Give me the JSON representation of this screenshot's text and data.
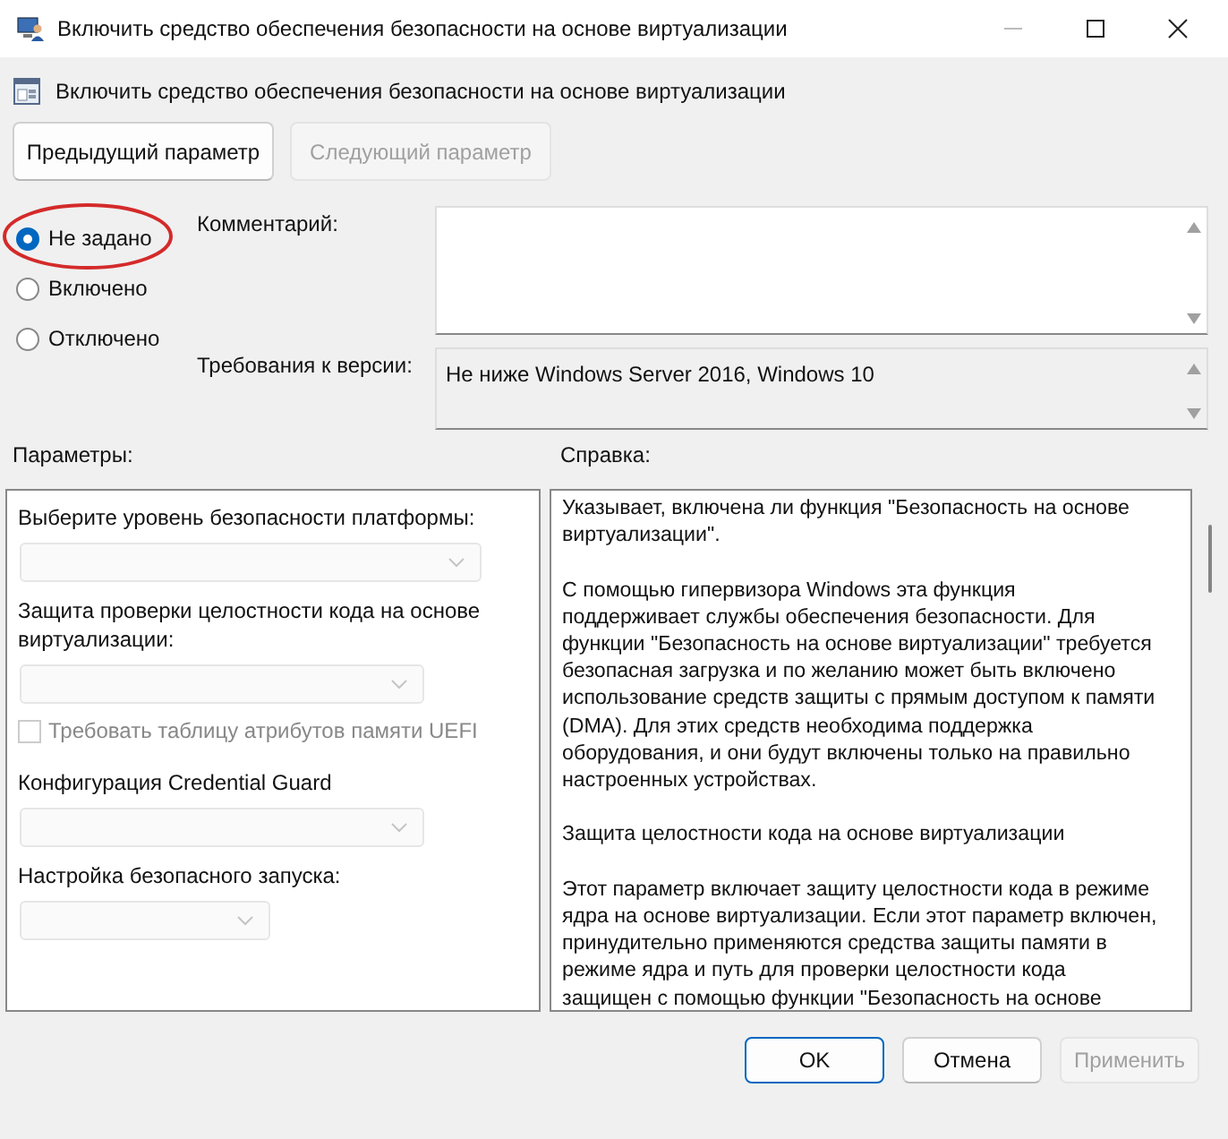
{
  "window": {
    "title": "Включить средство обеспечения безопасности на основе виртуализации"
  },
  "header": {
    "title": "Включить средство обеспечения безопасности на основе виртуализации"
  },
  "nav_buttons": [
    {
      "label": "Предыдущий параметр",
      "disabled": false
    },
    {
      "label": "Следующий параметр",
      "disabled": true
    }
  ],
  "state_options": [
    {
      "label": "Не задано",
      "selected": true
    },
    {
      "label": "Включено",
      "selected": false
    },
    {
      "label": "Отключено",
      "selected": false
    }
  ],
  "comment": {
    "label": "Комментарий:"
  },
  "requirements": {
    "label": "Требования к версии:",
    "value": "Не ниже Windows Server 2016, Windows 10"
  },
  "options_panel": {
    "title": "Параметры:",
    "items": [
      {
        "kind": "dropdown",
        "label": "Выберите уровень безопасности платформы:",
        "disabled": true
      },
      {
        "kind": "dropdown",
        "label": "Защита проверки целостности кода на основе виртуализации:",
        "disabled": true
      },
      {
        "kind": "checkbox",
        "label": "Требовать таблицу атрибутов памяти UEFI",
        "checked": false,
        "disabled": true
      },
      {
        "kind": "dropdown",
        "label": "Конфигурация Credential Guard",
        "disabled": true
      },
      {
        "kind": "dropdown",
        "label": "Настройка безопасного запуска:",
        "disabled": true
      }
    ]
  },
  "help_panel": {
    "title": "Справка:",
    "paragraphs": [
      [
        "Указывает, включена ли функция \"Безопасность на основе",
        "виртуализации\"."
      ],
      [
        "С помощью гипервизора Windows эта функция",
        "поддерживает службы обеспечения безопасности. Для",
        "функции \"Безопасность на основе виртуализации\" требуется",
        "безопасная загрузка и по желанию может быть включено",
        "использование средств защиты с прямым доступом к памяти",
        "(DMA). Для этих средств необходима поддержка",
        "оборудования, и они будут включены только на правильно",
        "настроенных устройствах."
      ],
      [
        "Защита целостности кода на основе виртуализации"
      ],
      [
        "Этот параметр включает защиту целостности кода в режиме",
        "ядра на основе виртуализации. Если этот параметр включен,",
        "принудительно применяются средства защиты памяти в",
        "режиме ядра и путь для проверки целостности кода",
        "защищен с помощью функции \"Безопасность на основе"
      ]
    ]
  },
  "dialog_buttons": [
    {
      "label": "OK",
      "default": true,
      "disabled": false
    },
    {
      "label": "Отмена",
      "default": false,
      "disabled": false
    },
    {
      "label": "Применить",
      "default": false,
      "disabled": true
    }
  ]
}
